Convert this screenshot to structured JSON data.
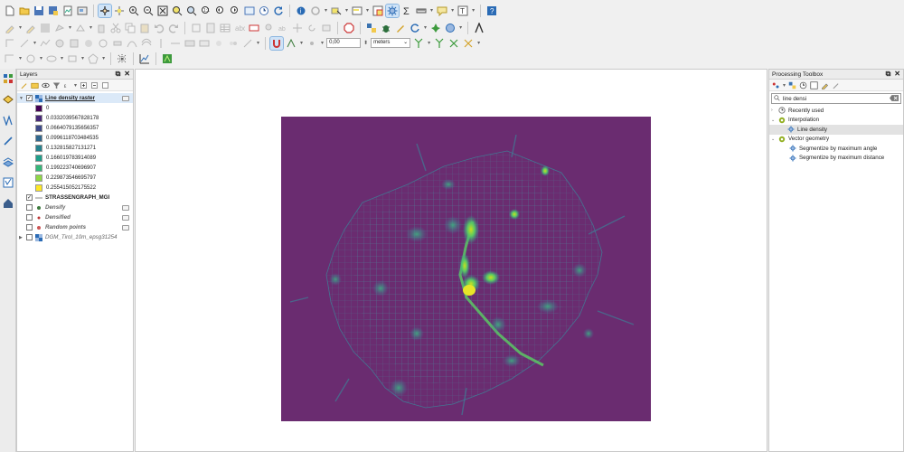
{
  "layers_panel": {
    "title": "Layers",
    "layers": [
      {
        "name": "Line density raster",
        "checked": true,
        "expanded": true,
        "type": "raster"
      },
      {
        "name": "STRASSENGRAPH_MGI",
        "checked": true,
        "type": "line"
      },
      {
        "name": "Densify",
        "checked": false,
        "type": "point"
      },
      {
        "name": "Densified",
        "checked": false,
        "type": "point"
      },
      {
        "name": "Random points",
        "checked": false,
        "type": "point"
      },
      {
        "name": "DGM_Tirol_10m_epsg31254",
        "checked": false,
        "type": "raster"
      }
    ],
    "legend": [
      {
        "value": "0",
        "color": "#440154"
      },
      {
        "value": "0.0332039567828178",
        "color": "#482878"
      },
      {
        "value": "0.0664079135656357",
        "color": "#3e4a89"
      },
      {
        "value": "0.0996118703484535",
        "color": "#31688e"
      },
      {
        "value": "0.132815827131271",
        "color": "#26828e"
      },
      {
        "value": "0.166019783914089",
        "color": "#1f9e89"
      },
      {
        "value": "0.199223740696907",
        "color": "#35b779"
      },
      {
        "value": "0.229873546695797",
        "color": "#8fd744"
      },
      {
        "value": "0.255415052175522",
        "color": "#fde725"
      }
    ]
  },
  "digitizing": {
    "tolerance_value": "0,00",
    "unit": "meters"
  },
  "toolbox": {
    "title": "Processing Toolbox",
    "search_value": "line densi",
    "groups": [
      {
        "label": "Recently used",
        "icon": "clock-icon"
      },
      {
        "label": "Interpolation",
        "icon": "qgis-icon",
        "items": [
          "Line density"
        ]
      },
      {
        "label": "Vector geometry",
        "icon": "qgis-icon",
        "items": [
          "Segmentize by maximum angle",
          "Segmentize by maximum distance"
        ]
      }
    ]
  },
  "map": {
    "background_color": "#6a2c70"
  }
}
